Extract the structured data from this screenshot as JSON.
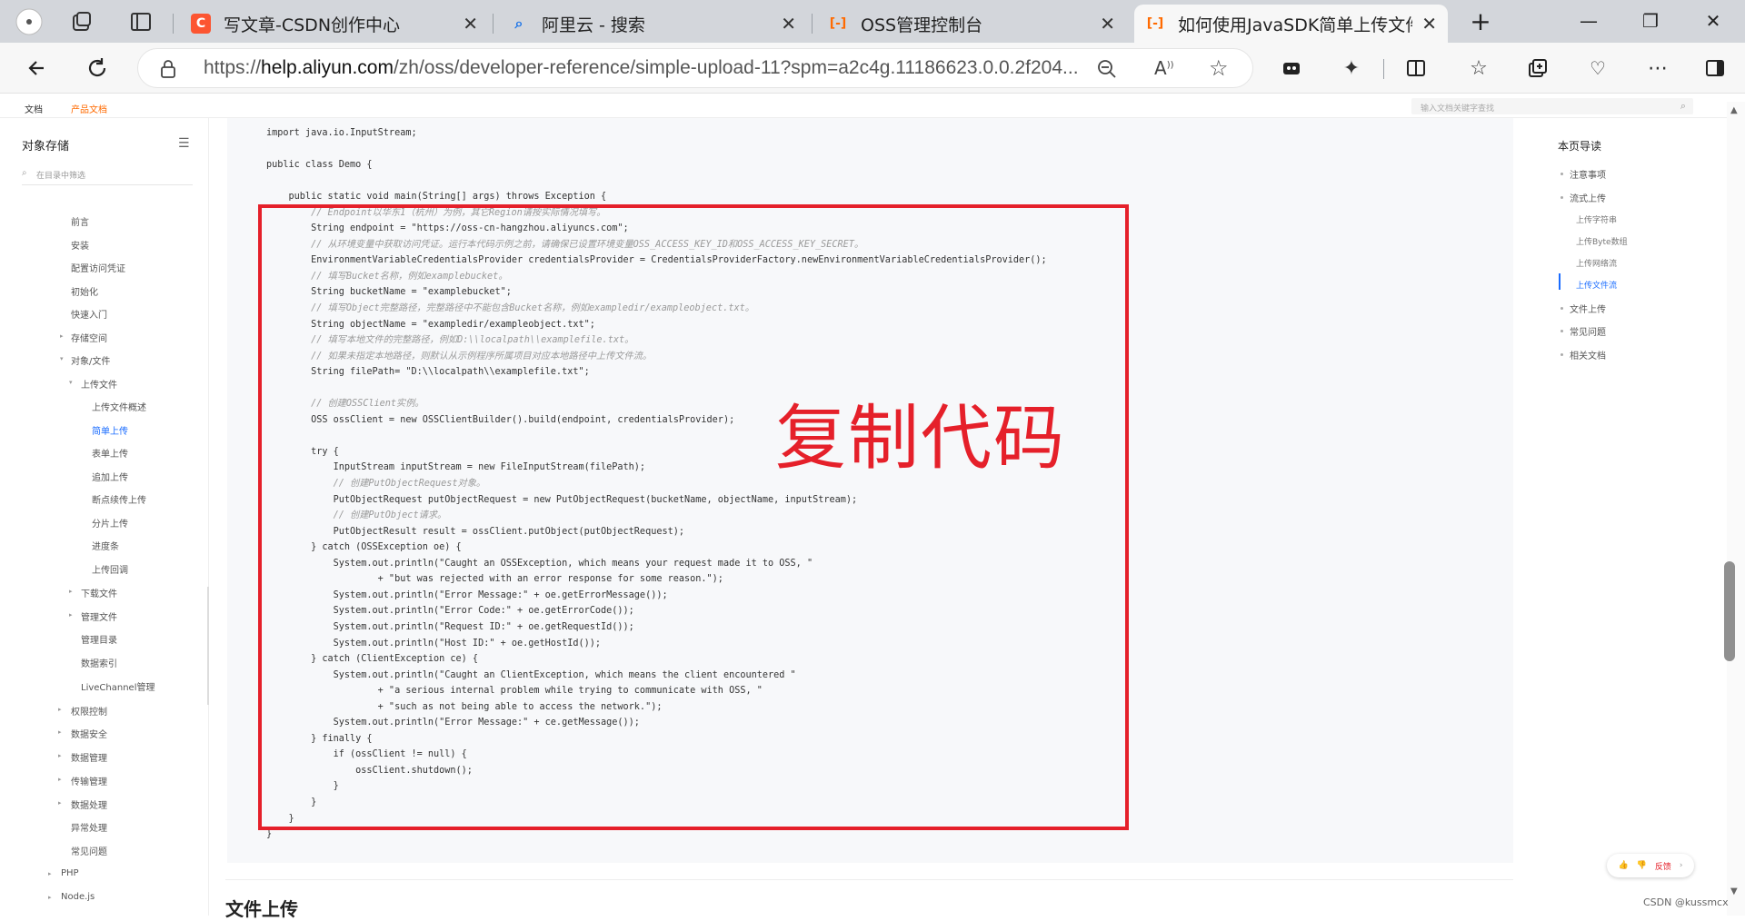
{
  "tabs": [
    {
      "title": "写文章-CSDN创作中心",
      "fav": "C",
      "color": "#fc5531"
    },
    {
      "title": "阿里云 - 搜索",
      "fav": "🔍",
      "color": "#1a73e8"
    },
    {
      "title": "OSS管理控制台",
      "fav": "[-]",
      "color": "#ff6a00"
    },
    {
      "title": "如何使用JavaSDK简单上传文件_",
      "fav": "[-]",
      "color": "#ff6a00"
    }
  ],
  "address": {
    "prefix": "https://",
    "host": "help.aliyun.com",
    "path": "/zh/oss/developer-reference/simple-upload-11?spm=a2c4g.11186623.0.0.2f204..."
  },
  "subnav": {
    "docs": "文档",
    "product_docs": "产品文档",
    "search_placeholder": "输入文档关键字查找"
  },
  "leftnav": {
    "title": "对象存储",
    "filter_placeholder": "在目录中筛选",
    "items": [
      "前言",
      "安装",
      "配置访问凭证",
      "初始化",
      "快速入门",
      "存储空间",
      "对象/文件",
      "上传文件",
      "上传文件概述",
      "简单上传",
      "表单上传",
      "追加上传",
      "断点续传上传",
      "分片上传",
      "进度条",
      "上传回调",
      "下载文件",
      "管理文件",
      "管理目录",
      "数据索引",
      "LiveChannel管理",
      "权限控制",
      "数据安全",
      "数据管理",
      "传输管理",
      "数据处理",
      "异常处理",
      "常见问题",
      "PHP",
      "Node.js"
    ]
  },
  "code_lines": [
    "import java.io.InputStream;",
    "",
    "public class Demo {",
    "",
    "    public static void main(String[] args) throws Exception {",
    "        // Endpoint以华东1（杭州）为例，其它Region请按实际情况填写。",
    "        String endpoint = \"https://oss-cn-hangzhou.aliyuncs.com\";",
    "        // 从环境变量中获取访问凭证。运行本代码示例之前，请确保已设置环境变量OSS_ACCESS_KEY_ID和OSS_ACCESS_KEY_SECRET。",
    "        EnvironmentVariableCredentialsProvider credentialsProvider = CredentialsProviderFactory.newEnvironmentVariableCredentialsProvider();",
    "        // 填写Bucket名称，例如examplebucket。",
    "        String bucketName = \"examplebucket\";",
    "        // 填写Object完整路径，完整路径中不能包含Bucket名称，例如exampledir/exampleobject.txt。",
    "        String objectName = \"exampledir/exampleobject.txt\";",
    "        // 填写本地文件的完整路径，例如D:\\\\localpath\\\\examplefile.txt。",
    "        // 如果未指定本地路径，则默认从示例程序所属项目对应本地路径中上传文件流。",
    "        String filePath= \"D:\\\\localpath\\\\examplefile.txt\";",
    "",
    "        // 创建OSSClient实例。",
    "        OSS ossClient = new OSSClientBuilder().build(endpoint, credentialsProvider);",
    "",
    "        try {",
    "            InputStream inputStream = new FileInputStream(filePath);",
    "            // 创建PutObjectRequest对象。",
    "            PutObjectRequest putObjectRequest = new PutObjectRequest(bucketName, objectName, inputStream);",
    "            // 创建PutObject请求。",
    "            PutObjectResult result = ossClient.putObject(putObjectRequest);",
    "        } catch (OSSException oe) {",
    "            System.out.println(\"Caught an OSSException, which means your request made it to OSS, \"",
    "                    + \"but was rejected with an error response for some reason.\");",
    "            System.out.println(\"Error Message:\" + oe.getErrorMessage());",
    "            System.out.println(\"Error Code:\" + oe.getErrorCode());",
    "            System.out.println(\"Request ID:\" + oe.getRequestId());",
    "            System.out.println(\"Host ID:\" + oe.getHostId());",
    "        } catch (ClientException ce) {",
    "            System.out.println(\"Caught an ClientException, which means the client encountered \"",
    "                    + \"a serious internal problem while trying to communicate with OSS, \"",
    "                    + \"such as not being able to access the network.\");",
    "            System.out.println(\"Error Message:\" + ce.getMessage());",
    "        } finally {",
    "            if (ossClient != null) {",
    "                ossClient.shutdown();",
    "            }",
    "        }",
    "    }",
    "}"
  ],
  "annotation": "复制代码",
  "section_heading": "文件上传",
  "rightnav": {
    "title": "本页导读",
    "items": [
      "注意事项",
      "流式上传",
      "上传字符串",
      "上传Byte数组",
      "上传网络流",
      "上传文件流",
      "文件上传",
      "常见问题",
      "相关文档"
    ]
  },
  "feedback": {
    "label": "反馈"
  },
  "watermark": "CSDN @kussmcx"
}
